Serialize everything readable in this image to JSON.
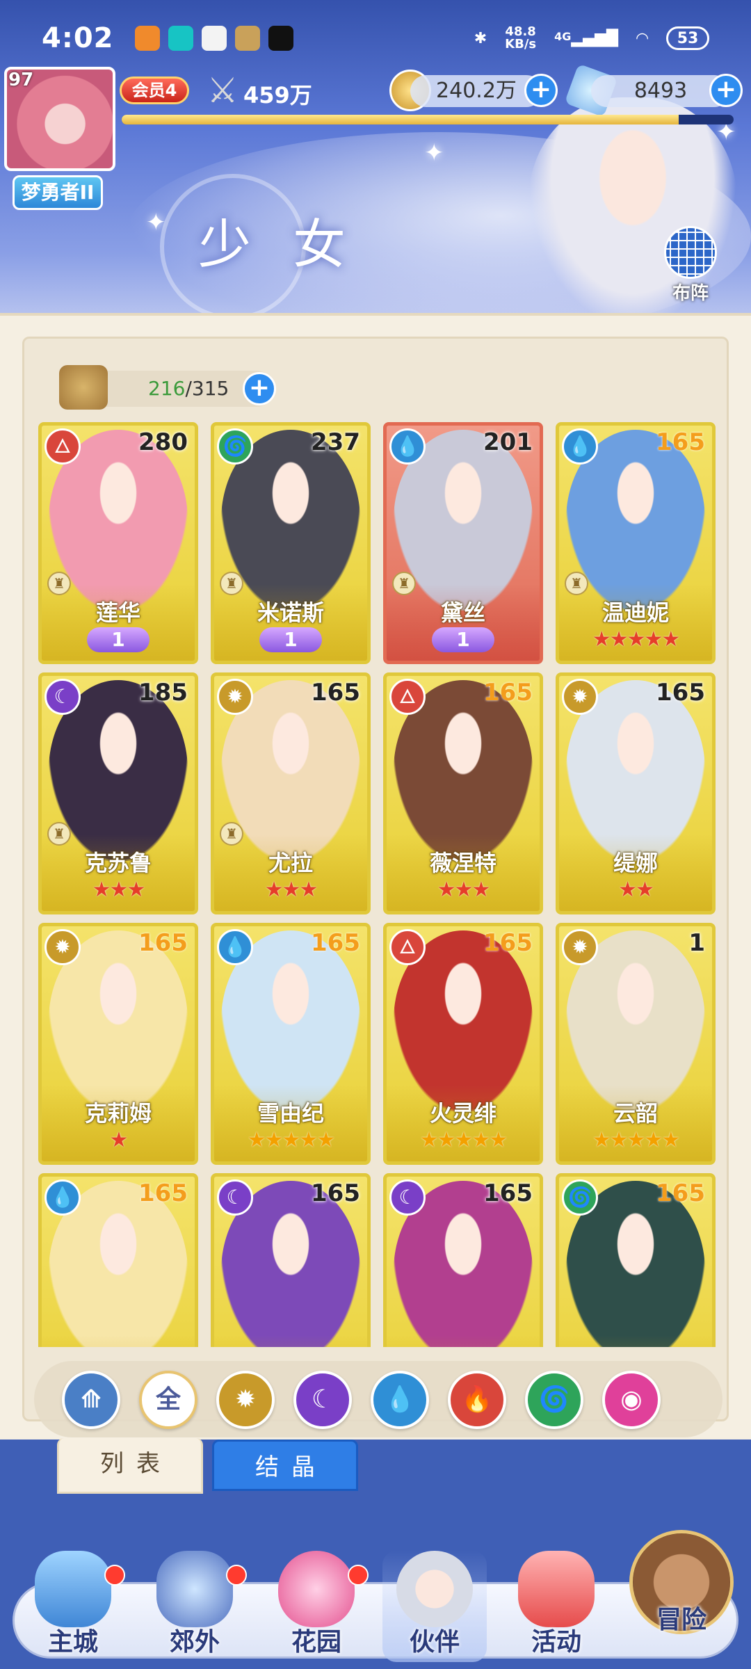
{
  "status_bar": {
    "time": "4:02",
    "net_speed": "48.8",
    "net_unit": "KB/s",
    "signal": "4G",
    "battery": "53"
  },
  "player": {
    "level": "97",
    "rank_title": "梦勇者II",
    "vip": "会员4",
    "power": "459万",
    "gold": "240.2万",
    "gems": "8493",
    "exp_progress": 0.91
  },
  "page": {
    "title": "少女",
    "formation_label": "布阵"
  },
  "roster": {
    "current": "216",
    "max": "/315"
  },
  "characters": [
    {
      "name": "莲华",
      "level": "280",
      "element": "fire",
      "stars": "",
      "awaken": "1",
      "role": true,
      "frame": "gold"
    },
    {
      "name": "米诺斯",
      "level": "237",
      "element": "wind",
      "stars": "",
      "awaken": "1",
      "role": true,
      "frame": "gold"
    },
    {
      "name": "黛丝",
      "level": "201",
      "element": "water",
      "stars": "",
      "awaken": "1",
      "role": true,
      "frame": "red"
    },
    {
      "name": "温迪妮",
      "level": "165",
      "element": "water",
      "stars": "★★★★★",
      "star_color": "red",
      "role": true,
      "frame": "gold",
      "level_gold": true
    },
    {
      "name": "克苏鲁",
      "level": "185",
      "element": "dark",
      "stars": "★★★",
      "star_color": "red",
      "role": true,
      "frame": "gold"
    },
    {
      "name": "尤拉",
      "level": "165",
      "element": "light",
      "stars": "★★★",
      "star_color": "red",
      "role": true,
      "frame": "gold"
    },
    {
      "name": "薇涅特",
      "level": "165",
      "element": "fire",
      "stars": "★★★",
      "star_color": "red",
      "role": false,
      "frame": "gold",
      "level_gold": true
    },
    {
      "name": "缇娜",
      "level": "165",
      "element": "light",
      "stars": "★★",
      "star_color": "red",
      "role": false,
      "frame": "gold"
    },
    {
      "name": "克莉姆",
      "level": "165",
      "element": "light",
      "stars": "★",
      "star_color": "red",
      "role": false,
      "frame": "gold",
      "level_gold": true
    },
    {
      "name": "雪由纪",
      "level": "165",
      "element": "water",
      "stars": "★★★★★",
      "star_color": "gold",
      "role": false,
      "frame": "gold",
      "level_gold": true
    },
    {
      "name": "火灵绯",
      "level": "165",
      "element": "fire",
      "stars": "★★★★★",
      "star_color": "gold",
      "role": false,
      "frame": "gold",
      "level_gold": true
    },
    {
      "name": "云韶",
      "level": "1",
      "element": "light",
      "stars": "★★★★★",
      "star_color": "gold",
      "role": false,
      "frame": "gold"
    },
    {
      "name": "",
      "level": "165",
      "element": "water",
      "stars": "",
      "role": false,
      "frame": "gold",
      "level_gold": true
    },
    {
      "name": "",
      "level": "165",
      "element": "dark",
      "stars": "",
      "role": false,
      "frame": "gold"
    },
    {
      "name": "",
      "level": "165",
      "element": "dark",
      "stars": "",
      "role": false,
      "frame": "gold"
    },
    {
      "name": "",
      "level": "165",
      "element": "wind",
      "stars": "",
      "role": false,
      "frame": "gold",
      "level_gold": true
    }
  ],
  "filters": [
    {
      "id": "sort",
      "label": "⟰"
    },
    {
      "id": "all",
      "label": "全"
    },
    {
      "id": "light",
      "label": "✹"
    },
    {
      "id": "dark",
      "label": "☾"
    },
    {
      "id": "water",
      "label": "💧"
    },
    {
      "id": "fire",
      "label": "🔥"
    },
    {
      "id": "wind",
      "label": "🌀"
    },
    {
      "id": "psy",
      "label": "◉"
    }
  ],
  "element_colors": {
    "fire": "#d9463b",
    "wind": "#2ea45a",
    "water": "#2f8fd6",
    "dark": "#7a3fc7",
    "light": "#c89a2a",
    "psy": "#e0409a",
    "sort": "#4a7fc6"
  },
  "tabs": {
    "list": "列表",
    "crystal": "结晶"
  },
  "nav": {
    "city": "主城",
    "suburb": "郊外",
    "garden": "花园",
    "partner": "伙伴",
    "events": "活动",
    "adventure": "冒险"
  }
}
